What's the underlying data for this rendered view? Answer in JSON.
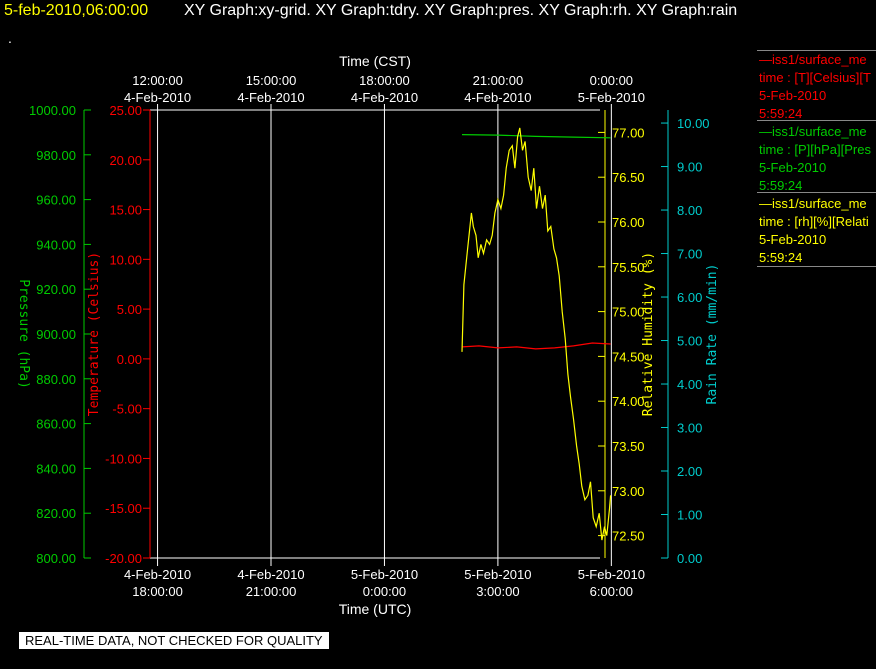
{
  "header": {
    "timestamp": "5-feb-2010,06:00:00",
    "graphs": "XY Graph:xy-grid.  XY Graph:tdry.  XY Graph:pres.  XY Graph:rh.  XY Graph:rain",
    "dot": "."
  },
  "colors": {
    "background": "#000000",
    "pressure": "#00cc00",
    "temperature": "#ff0000",
    "humidity": "#ffff00",
    "rain": "#00cccc",
    "grid": "#ffffff"
  },
  "legend": [
    {
      "title": "—iss1/surface_me",
      "desc": "time : [T][Celsius][T",
      "date": "5-Feb-2010",
      "time": "5:59:24",
      "color": "#ff0000"
    },
    {
      "title": "—iss1/surface_me",
      "desc": "time : [P][hPa][Pres",
      "date": "5-Feb-2010",
      "time": "5:59:24",
      "color": "#00cc00"
    },
    {
      "title": "—iss1/surface_me",
      "desc": "time : [rh][%][Relati",
      "date": "5-Feb-2010",
      "time": "5:59:24",
      "color": "#ffff00"
    }
  ],
  "footer": {
    "text": "REAL-TIME DATA, NOT CHECKED FOR QUALITY"
  },
  "chart_data": {
    "type": "line",
    "x_label_top": "Time (CST)",
    "x_label_bottom": "Time (UTC)",
    "x_range_hours": [
      -0.2,
      11.7
    ],
    "top_ticks": [
      {
        "h": 0,
        "time": "12:00:00",
        "date": "4-Feb-2010"
      },
      {
        "h": 3,
        "time": "15:00:00",
        "date": "4-Feb-2010"
      },
      {
        "h": 6,
        "time": "18:00:00",
        "date": "4-Feb-2010"
      },
      {
        "h": 9,
        "time": "21:00:00",
        "date": "4-Feb-2010"
      },
      {
        "h": 12,
        "time": "0:00:00",
        "date": "5-Feb-2010"
      }
    ],
    "bottom_ticks": [
      {
        "h": 0,
        "date": "4-Feb-2010",
        "time": "18:00:00"
      },
      {
        "h": 3,
        "date": "4-Feb-2010",
        "time": "21:00:00"
      },
      {
        "h": 6,
        "date": "5-Feb-2010",
        "time": "0:00:00"
      },
      {
        "h": 9,
        "date": "5-Feb-2010",
        "time": "3:00:00"
      },
      {
        "h": 12,
        "date": "5-Feb-2010",
        "time": "6:00:00"
      }
    ],
    "axes": {
      "pressure": {
        "label": "Pressure (hPa)",
        "min": 800,
        "max": 1000,
        "ticks": [
          "1000.00",
          "980.00",
          "960.00",
          "940.00",
          "920.00",
          "900.00",
          "880.00",
          "860.00",
          "840.00",
          "820.00",
          "800.00"
        ]
      },
      "temperature": {
        "label": "Temperature (Celsius)",
        "min": -20,
        "max": 25,
        "ticks": [
          "25.00",
          "20.00",
          "15.00",
          "10.00",
          "5.00",
          "0.00",
          "-5.00",
          "-10.00",
          "-15.00",
          "-20.00"
        ]
      },
      "humidity": {
        "label": "Relative Humidity (%)",
        "min": 72.25,
        "max": 77.25,
        "ticks": [
          "77.00",
          "76.50",
          "76.00",
          "75.50",
          "75.00",
          "74.50",
          "74.00",
          "73.50",
          "73.00",
          "72.50"
        ]
      },
      "rain": {
        "label": "Rain Rate (mm/min)",
        "min": 0,
        "max": 10.3,
        "ticks": [
          "10.00",
          "9.00",
          "8.00",
          "7.00",
          "6.00",
          "5.00",
          "4.00",
          "3.00",
          "2.00",
          "1.00",
          "0.00"
        ]
      }
    },
    "series": [
      {
        "key": "pressure",
        "x": [
          8.05,
          9.0,
          10.0,
          11.0,
          11.98
        ],
        "y": [
          989.0,
          988.8,
          988.2,
          987.9,
          987.6
        ]
      },
      {
        "key": "temperature",
        "x": [
          8.05,
          8.5,
          9.0,
          9.5,
          10.0,
          10.5,
          11.0,
          11.5,
          11.98
        ],
        "y": [
          1.2,
          1.3,
          1.1,
          1.2,
          1.0,
          1.1,
          1.3,
          1.6,
          1.5
        ]
      },
      {
        "key": "humidity",
        "x": [
          8.05,
          8.1,
          8.2,
          8.3,
          8.35,
          8.42,
          8.48,
          8.55,
          8.62,
          8.7,
          8.78,
          8.85,
          8.92,
          9.0,
          9.08,
          9.15,
          9.22,
          9.3,
          9.38,
          9.45,
          9.52,
          9.58,
          9.65,
          9.72,
          9.8,
          9.88,
          9.95,
          10.02,
          10.1,
          10.18,
          10.25,
          10.32,
          10.4,
          10.48,
          10.55,
          10.62,
          10.7,
          10.78,
          10.85,
          10.92,
          11.0,
          11.08,
          11.15,
          11.22,
          11.3,
          11.38,
          11.45,
          11.52,
          11.6,
          11.68,
          11.75,
          11.82,
          11.88,
          11.95,
          11.98
        ],
        "y": [
          74.55,
          75.3,
          75.7,
          76.1,
          75.95,
          75.85,
          75.6,
          75.75,
          75.65,
          75.8,
          75.75,
          75.85,
          76.1,
          76.25,
          76.15,
          76.3,
          76.6,
          76.8,
          76.85,
          76.6,
          76.95,
          77.05,
          76.8,
          76.9,
          76.5,
          76.35,
          76.6,
          76.15,
          76.4,
          76.15,
          76.3,
          75.9,
          75.95,
          75.7,
          75.6,
          75.4,
          75.0,
          74.7,
          74.3,
          74.05,
          73.8,
          73.5,
          73.3,
          73.05,
          72.9,
          72.95,
          73.1,
          72.7,
          72.6,
          72.75,
          72.45,
          72.6,
          72.5,
          72.8,
          72.95
        ]
      }
    ]
  }
}
